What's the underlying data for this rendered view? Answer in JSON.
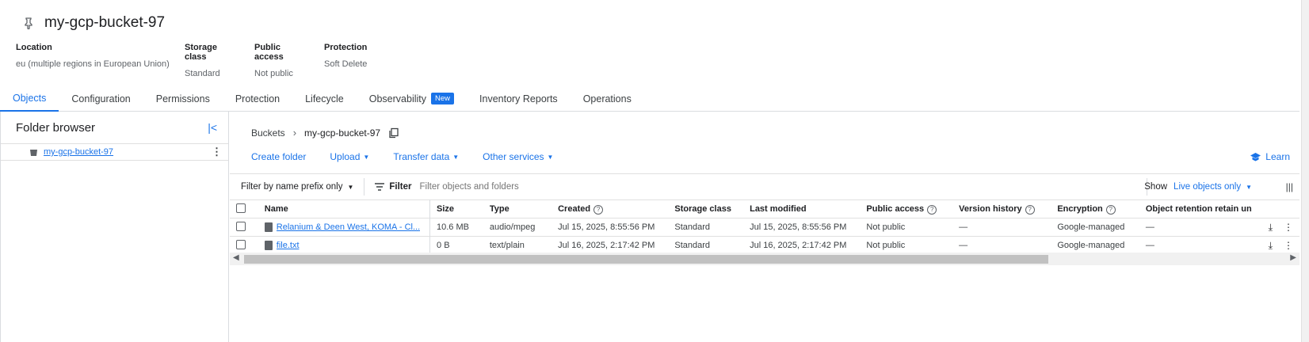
{
  "bucket": {
    "name": "my-gcp-bucket-97"
  },
  "meta": [
    {
      "key": "Location",
      "value": "eu (multiple regions in European Union)"
    },
    {
      "key": "Storage class",
      "value": "Standard"
    },
    {
      "key": "Public access",
      "value": "Not public"
    },
    {
      "key": "Protection",
      "value": "Soft Delete"
    }
  ],
  "tabs": [
    {
      "label": "Objects"
    },
    {
      "label": "Configuration"
    },
    {
      "label": "Permissions"
    },
    {
      "label": "Protection"
    },
    {
      "label": "Lifecycle"
    },
    {
      "label": "Observability",
      "badge": "New"
    },
    {
      "label": "Inventory Reports"
    },
    {
      "label": "Operations"
    }
  ],
  "folder_browser": {
    "title": "Folder browser",
    "item": "my-gcp-bucket-97"
  },
  "breadcrumb": {
    "root": "Buckets",
    "current": "my-gcp-bucket-97"
  },
  "actions": {
    "create_folder": "Create folder",
    "upload": "Upload",
    "transfer": "Transfer data",
    "other": "Other services",
    "learn": "Learn"
  },
  "filter": {
    "prefix": "Filter by name prefix only",
    "label": "Filter",
    "placeholder": "Filter objects and folders",
    "show_label": "Show",
    "show_value": "Live objects only"
  },
  "columns": [
    "Name",
    "Size",
    "Type",
    "Created",
    "Storage class",
    "Last modified",
    "Public access",
    "Version history",
    "Encryption",
    "Object retention retain un"
  ],
  "rows": [
    [
      "Relanium & Deen West, KOMA - Cl...",
      "10.6 MB",
      "audio/mpeg",
      "Jul 15, 2025, 8:55:56 PM",
      "Standard",
      "Jul 15, 2025, 8:55:56 PM",
      "Not public",
      "—",
      "Google-managed",
      "—"
    ],
    [
      "file.txt",
      "0 B",
      "text/plain",
      "Jul 16, 2025, 2:17:42 PM",
      "Standard",
      "Jul 16, 2025, 2:17:42 PM",
      "Not public",
      "—",
      "Google-managed",
      "—"
    ]
  ]
}
